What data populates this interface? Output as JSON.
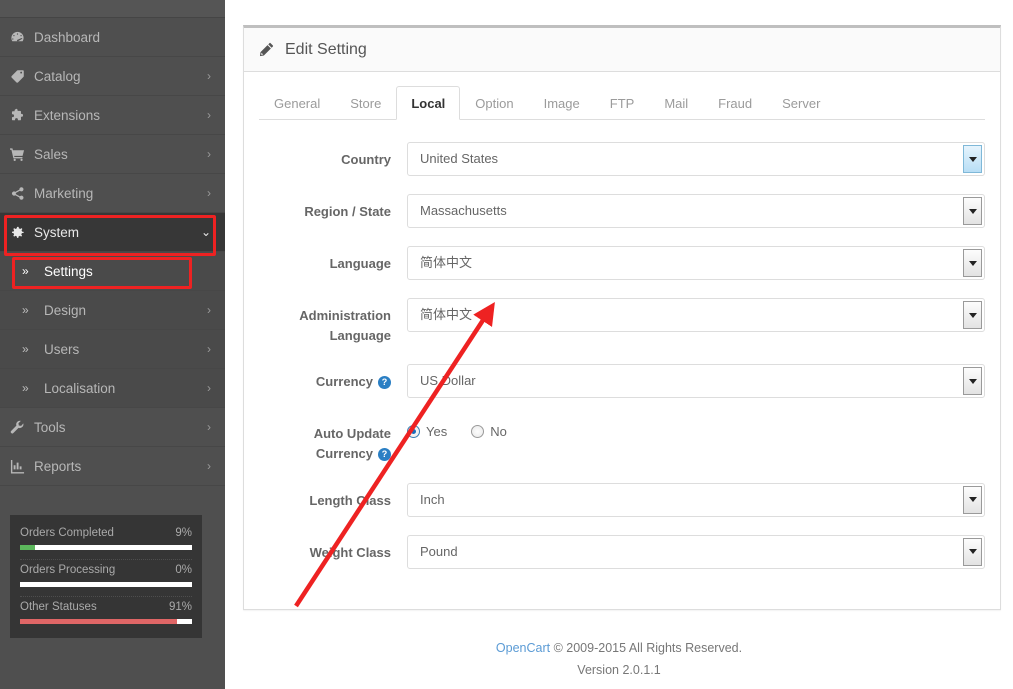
{
  "sidebar": {
    "items": [
      {
        "label": "Dashboard",
        "icon": "dashboard-icon",
        "caret": "",
        "level": "top"
      },
      {
        "label": "Catalog",
        "icon": "tag-icon",
        "caret": "›",
        "level": "top"
      },
      {
        "label": "Extensions",
        "icon": "puzzle-icon",
        "caret": "›",
        "level": "top"
      },
      {
        "label": "Sales",
        "icon": "cart-icon",
        "caret": "›",
        "level": "top"
      },
      {
        "label": "Marketing",
        "icon": "share-icon",
        "caret": "›",
        "level": "top"
      },
      {
        "label": "System",
        "icon": "gear-icon",
        "caret": "⌄",
        "level": "top",
        "active": true
      },
      {
        "label": "Settings",
        "icon": "chevrons-right-icon",
        "caret": "",
        "level": "sub",
        "current": true
      },
      {
        "label": "Design",
        "icon": "chevrons-right-icon",
        "caret": "›",
        "level": "sub"
      },
      {
        "label": "Users",
        "icon": "chevrons-right-icon",
        "caret": "›",
        "level": "sub"
      },
      {
        "label": "Localisation",
        "icon": "chevrons-right-icon",
        "caret": "›",
        "level": "sub"
      },
      {
        "label": "Tools",
        "icon": "wrench-icon",
        "caret": "›",
        "level": "top"
      },
      {
        "label": "Reports",
        "icon": "chart-icon",
        "caret": "›",
        "level": "top"
      }
    ],
    "stats": [
      {
        "label": "Orders Completed",
        "percent": "9%",
        "value": 9,
        "color": "#5cb85c"
      },
      {
        "label": "Orders Processing",
        "percent": "0%",
        "value": 0,
        "color": "#5bc0de"
      },
      {
        "label": "Other Statuses",
        "percent": "91%",
        "value": 91,
        "color": "#e06666"
      }
    ]
  },
  "panel": {
    "title": "Edit Setting",
    "tabs": [
      {
        "label": "General"
      },
      {
        "label": "Store"
      },
      {
        "label": "Local",
        "active": true
      },
      {
        "label": "Option"
      },
      {
        "label": "Image"
      },
      {
        "label": "FTP"
      },
      {
        "label": "Mail"
      },
      {
        "label": "Fraud"
      },
      {
        "label": "Server"
      }
    ],
    "fields": [
      {
        "label": "Country",
        "type": "select",
        "value": "United States",
        "help": false,
        "focused": true
      },
      {
        "label": "Region / State",
        "type": "select",
        "value": "Massachusetts",
        "help": false
      },
      {
        "label": "Language",
        "type": "select",
        "value": "简体中文",
        "help": false
      },
      {
        "label": "Administration Language",
        "type": "select",
        "value": "简体中文",
        "help": false
      },
      {
        "label": "Currency",
        "type": "select",
        "value": "US Dollar",
        "help": true
      },
      {
        "label": "Auto Update Currency",
        "type": "radio",
        "help": true,
        "options": [
          {
            "label": "Yes",
            "checked": true
          },
          {
            "label": "No",
            "checked": false
          }
        ]
      },
      {
        "label": "Length Class",
        "type": "select",
        "value": "Inch",
        "help": false
      },
      {
        "label": "Weight Class",
        "type": "select",
        "value": "Pound",
        "help": false
      }
    ],
    "help_glyph": "?"
  },
  "footer": {
    "brand": "OpenCart",
    "copyright": "© 2009-2015 All Rights Reserved.",
    "version": "Version 2.0.1.1"
  },
  "annotations": {
    "highlight_color": "#ee2222",
    "arrow_color": "#ee2222"
  }
}
